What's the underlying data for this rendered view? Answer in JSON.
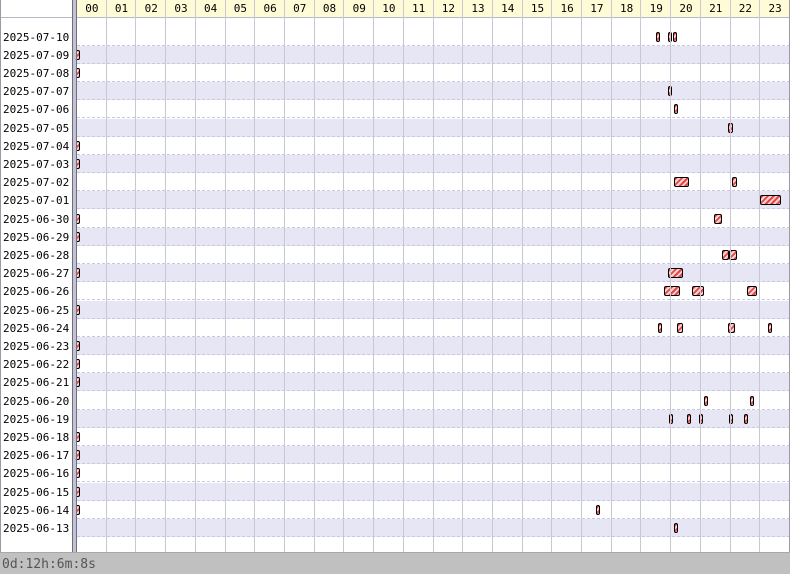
{
  "hours": [
    "00",
    "01",
    "02",
    "03",
    "04",
    "05",
    "06",
    "07",
    "08",
    "09",
    "10",
    "11",
    "12",
    "13",
    "14",
    "15",
    "16",
    "17",
    "18",
    "19",
    "20",
    "21",
    "22",
    "23"
  ],
  "rows": [
    {
      "date": "2025-07-10",
      "sessions": [
        [
          19.48,
          19.62
        ],
        [
          19.9,
          20.0
        ],
        [
          20.05,
          20.15
        ]
      ]
    },
    {
      "date": "2025-07-09",
      "sessions": [
        [
          0.0,
          0.2
        ]
      ]
    },
    {
      "date": "2025-07-08",
      "sessions": [
        [
          0.0,
          0.2
        ]
      ]
    },
    {
      "date": "2025-07-07",
      "sessions": [
        [
          19.9,
          20.03
        ]
      ]
    },
    {
      "date": "2025-07-06",
      "sessions": [
        [
          20.1,
          20.2
        ]
      ]
    },
    {
      "date": "2025-07-05",
      "sessions": [
        [
          21.9,
          22.08
        ]
      ]
    },
    {
      "date": "2025-07-04",
      "sessions": [
        [
          0.0,
          0.2
        ]
      ]
    },
    {
      "date": "2025-07-03",
      "sessions": [
        [
          0.0,
          0.2
        ]
      ]
    },
    {
      "date": "2025-07-02",
      "sessions": [
        [
          20.1,
          20.6
        ],
        [
          22.05,
          22.2
        ]
      ]
    },
    {
      "date": "2025-07-01",
      "sessions": [
        [
          23.0,
          23.7
        ]
      ]
    },
    {
      "date": "2025-06-30",
      "sessions": [
        [
          0.0,
          0.2
        ],
        [
          21.45,
          21.72
        ]
      ]
    },
    {
      "date": "2025-06-29",
      "sessions": [
        [
          0.0,
          0.2
        ]
      ]
    },
    {
      "date": "2025-06-28",
      "sessions": [
        [
          21.7,
          21.95
        ],
        [
          21.95,
          22.22
        ]
      ]
    },
    {
      "date": "2025-06-27",
      "sessions": [
        [
          0.0,
          0.2
        ],
        [
          19.9,
          20.4
        ]
      ]
    },
    {
      "date": "2025-06-26",
      "sessions": [
        [
          19.75,
          20.3
        ],
        [
          20.7,
          21.1
        ],
        [
          22.55,
          22.9
        ]
      ]
    },
    {
      "date": "2025-06-25",
      "sessions": [
        [
          0.0,
          0.2
        ]
      ]
    },
    {
      "date": "2025-06-24",
      "sessions": [
        [
          19.55,
          19.68
        ],
        [
          20.2,
          20.4
        ],
        [
          21.9,
          22.15
        ],
        [
          23.25,
          23.38
        ]
      ]
    },
    {
      "date": "2025-06-23",
      "sessions": [
        [
          0.0,
          0.2
        ]
      ]
    },
    {
      "date": "2025-06-22",
      "sessions": [
        [
          0.0,
          0.2
        ]
      ]
    },
    {
      "date": "2025-06-21",
      "sessions": [
        [
          0.0,
          0.2
        ]
      ]
    },
    {
      "date": "2025-06-20",
      "sessions": [
        [
          21.1,
          21.2
        ],
        [
          22.65,
          22.78
        ]
      ]
    },
    {
      "date": "2025-06-19",
      "sessions": [
        [
          19.92,
          20.03
        ],
        [
          20.53,
          20.63
        ],
        [
          20.95,
          21.08
        ],
        [
          21.95,
          22.08
        ],
        [
          22.45,
          22.6
        ]
      ]
    },
    {
      "date": "2025-06-18",
      "sessions": [
        [
          0.0,
          0.2
        ]
      ]
    },
    {
      "date": "2025-06-17",
      "sessions": [
        [
          0.0,
          0.2
        ]
      ]
    },
    {
      "date": "2025-06-16",
      "sessions": [
        [
          0.0,
          0.2
        ]
      ]
    },
    {
      "date": "2025-06-15",
      "sessions": [
        [
          0.0,
          0.2
        ]
      ]
    },
    {
      "date": "2025-06-14",
      "sessions": [
        [
          0.0,
          0.2
        ],
        [
          17.48,
          17.62
        ]
      ]
    },
    {
      "date": "2025-06-13",
      "sessions": [
        [
          20.1,
          20.2
        ]
      ]
    }
  ],
  "status": {
    "elapsed": "0d:12h:6m:8s"
  },
  "colors": {
    "header": "#fffbd6",
    "row_alt": "#e6e6f5",
    "bar_fill": "#e04848",
    "status_bg": "#c0c0c0"
  }
}
